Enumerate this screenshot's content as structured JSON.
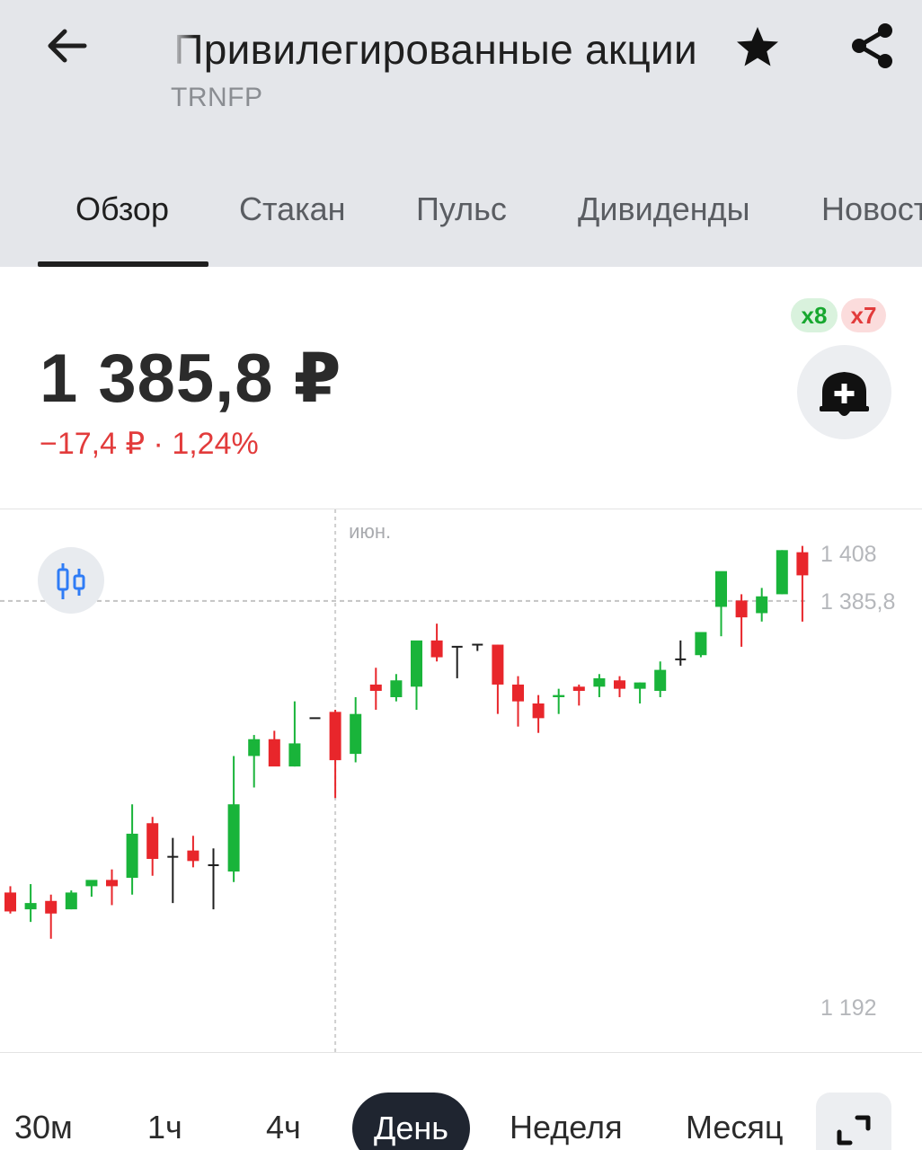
{
  "header": {
    "title": "Привилегированные акции",
    "ticker": "TRNFP",
    "back_icon": "arrow-left-icon",
    "favorite_icon": "star-icon",
    "share_icon": "share-icon"
  },
  "tabs": [
    {
      "label": "Обзор",
      "active": true
    },
    {
      "label": "Стакан",
      "active": false
    },
    {
      "label": "Пульс",
      "active": false
    },
    {
      "label": "Дивиденды",
      "active": false
    },
    {
      "label": "Новости",
      "active": false
    }
  ],
  "quote": {
    "price": "1 385,8 ₽",
    "change": "−17,4 ₽ · 1,24%",
    "badge_up": "x8",
    "badge_down": "x7",
    "alert_icon": "bell-plus-icon"
  },
  "colors": {
    "up": "#19b43a",
    "down": "#e8262b",
    "neutral": "#1f1f1f",
    "accent": "#2f7cf6"
  },
  "chart_data": {
    "type": "candlestick",
    "month_label": "июн.",
    "y_ticks": [
      "1 408",
      "1 192"
    ],
    "current_price_label": "1 385,8",
    "ylim": [
      1192,
      1408
    ],
    "indicator_icon": "candles-icon",
    "candles": [
      {
        "o": 1247,
        "h": 1250,
        "l": 1237,
        "c": 1238
      },
      {
        "o": 1239,
        "h": 1251,
        "l": 1233,
        "c": 1242
      },
      {
        "o": 1243,
        "h": 1246,
        "l": 1225,
        "c": 1237
      },
      {
        "o": 1239,
        "h": 1248,
        "l": 1239,
        "c": 1247
      },
      {
        "o": 1250,
        "h": 1252,
        "l": 1245,
        "c": 1253
      },
      {
        "o": 1253,
        "h": 1258,
        "l": 1241,
        "c": 1250
      },
      {
        "o": 1254,
        "h": 1289,
        "l": 1246,
        "c": 1275
      },
      {
        "o": 1280,
        "h": 1283,
        "l": 1255,
        "c": 1263
      },
      {
        "o": 1264,
        "h": 1273,
        "l": 1242,
        "c": 1264
      },
      {
        "o": 1267,
        "h": 1274,
        "l": 1259,
        "c": 1262
      },
      {
        "o": 1260,
        "h": 1268,
        "l": 1239,
        "c": 1260
      },
      {
        "o": 1257,
        "h": 1312,
        "l": 1252,
        "c": 1289
      },
      {
        "o": 1312,
        "h": 1322,
        "l": 1297,
        "c": 1320
      },
      {
        "o": 1320,
        "h": 1324,
        "l": 1310,
        "c": 1307
      },
      {
        "o": 1307,
        "h": 1338,
        "l": 1307,
        "c": 1318
      },
      {
        "o": 1330,
        "h": 1330,
        "l": 1330,
        "c": 1330
      },
      {
        "o": 1333,
        "h": 1334,
        "l": 1292,
        "c": 1310
      },
      {
        "o": 1313,
        "h": 1340,
        "l": 1309,
        "c": 1332
      },
      {
        "o": 1346,
        "h": 1354,
        "l": 1334,
        "c": 1343
      },
      {
        "o": 1340,
        "h": 1351,
        "l": 1338,
        "c": 1348
      },
      {
        "o": 1345,
        "h": 1355,
        "l": 1334,
        "c": 1367
      },
      {
        "o": 1367,
        "h": 1375,
        "l": 1357,
        "c": 1359
      },
      {
        "o": 1364,
        "h": 1364,
        "l": 1349,
        "c": 1364
      },
      {
        "o": 1365,
        "h": 1365,
        "l": 1362,
        "c": 1365
      },
      {
        "o": 1365,
        "h": 1365,
        "l": 1332,
        "c": 1346
      },
      {
        "o": 1346,
        "h": 1350,
        "l": 1326,
        "c": 1338
      },
      {
        "o": 1337,
        "h": 1341,
        "l": 1323,
        "c": 1330
      },
      {
        "o": 1340,
        "h": 1344,
        "l": 1332,
        "c": 1341
      },
      {
        "o": 1345,
        "h": 1346,
        "l": 1336,
        "c": 1343
      },
      {
        "o": 1345,
        "h": 1351,
        "l": 1340,
        "c": 1349
      },
      {
        "o": 1348,
        "h": 1350,
        "l": 1340,
        "c": 1344
      },
      {
        "o": 1344,
        "h": 1347,
        "l": 1337,
        "c": 1347
      },
      {
        "o": 1343,
        "h": 1357,
        "l": 1340,
        "c": 1353
      },
      {
        "o": 1358,
        "h": 1367,
        "l": 1355,
        "c": 1358
      },
      {
        "o": 1360,
        "h": 1371,
        "l": 1359,
        "c": 1371
      },
      {
        "o": 1383,
        "h": 1395,
        "l": 1369,
        "c": 1400
      },
      {
        "o": 1386,
        "h": 1389,
        "l": 1364,
        "c": 1378
      },
      {
        "o": 1380,
        "h": 1392,
        "l": 1376,
        "c": 1388
      },
      {
        "o": 1389,
        "h": 1410,
        "l": 1389,
        "c": 1410
      },
      {
        "o": 1409,
        "h": 1412,
        "l": 1376,
        "c": 1398
      }
    ]
  },
  "periods": [
    {
      "label": "30м",
      "active": false
    },
    {
      "label": "1ч",
      "active": false
    },
    {
      "label": "4ч",
      "active": false
    },
    {
      "label": "День",
      "active": true
    },
    {
      "label": "Неделя",
      "active": false
    },
    {
      "label": "Месяц",
      "active": false
    }
  ],
  "expand_icon": "expand-icon"
}
